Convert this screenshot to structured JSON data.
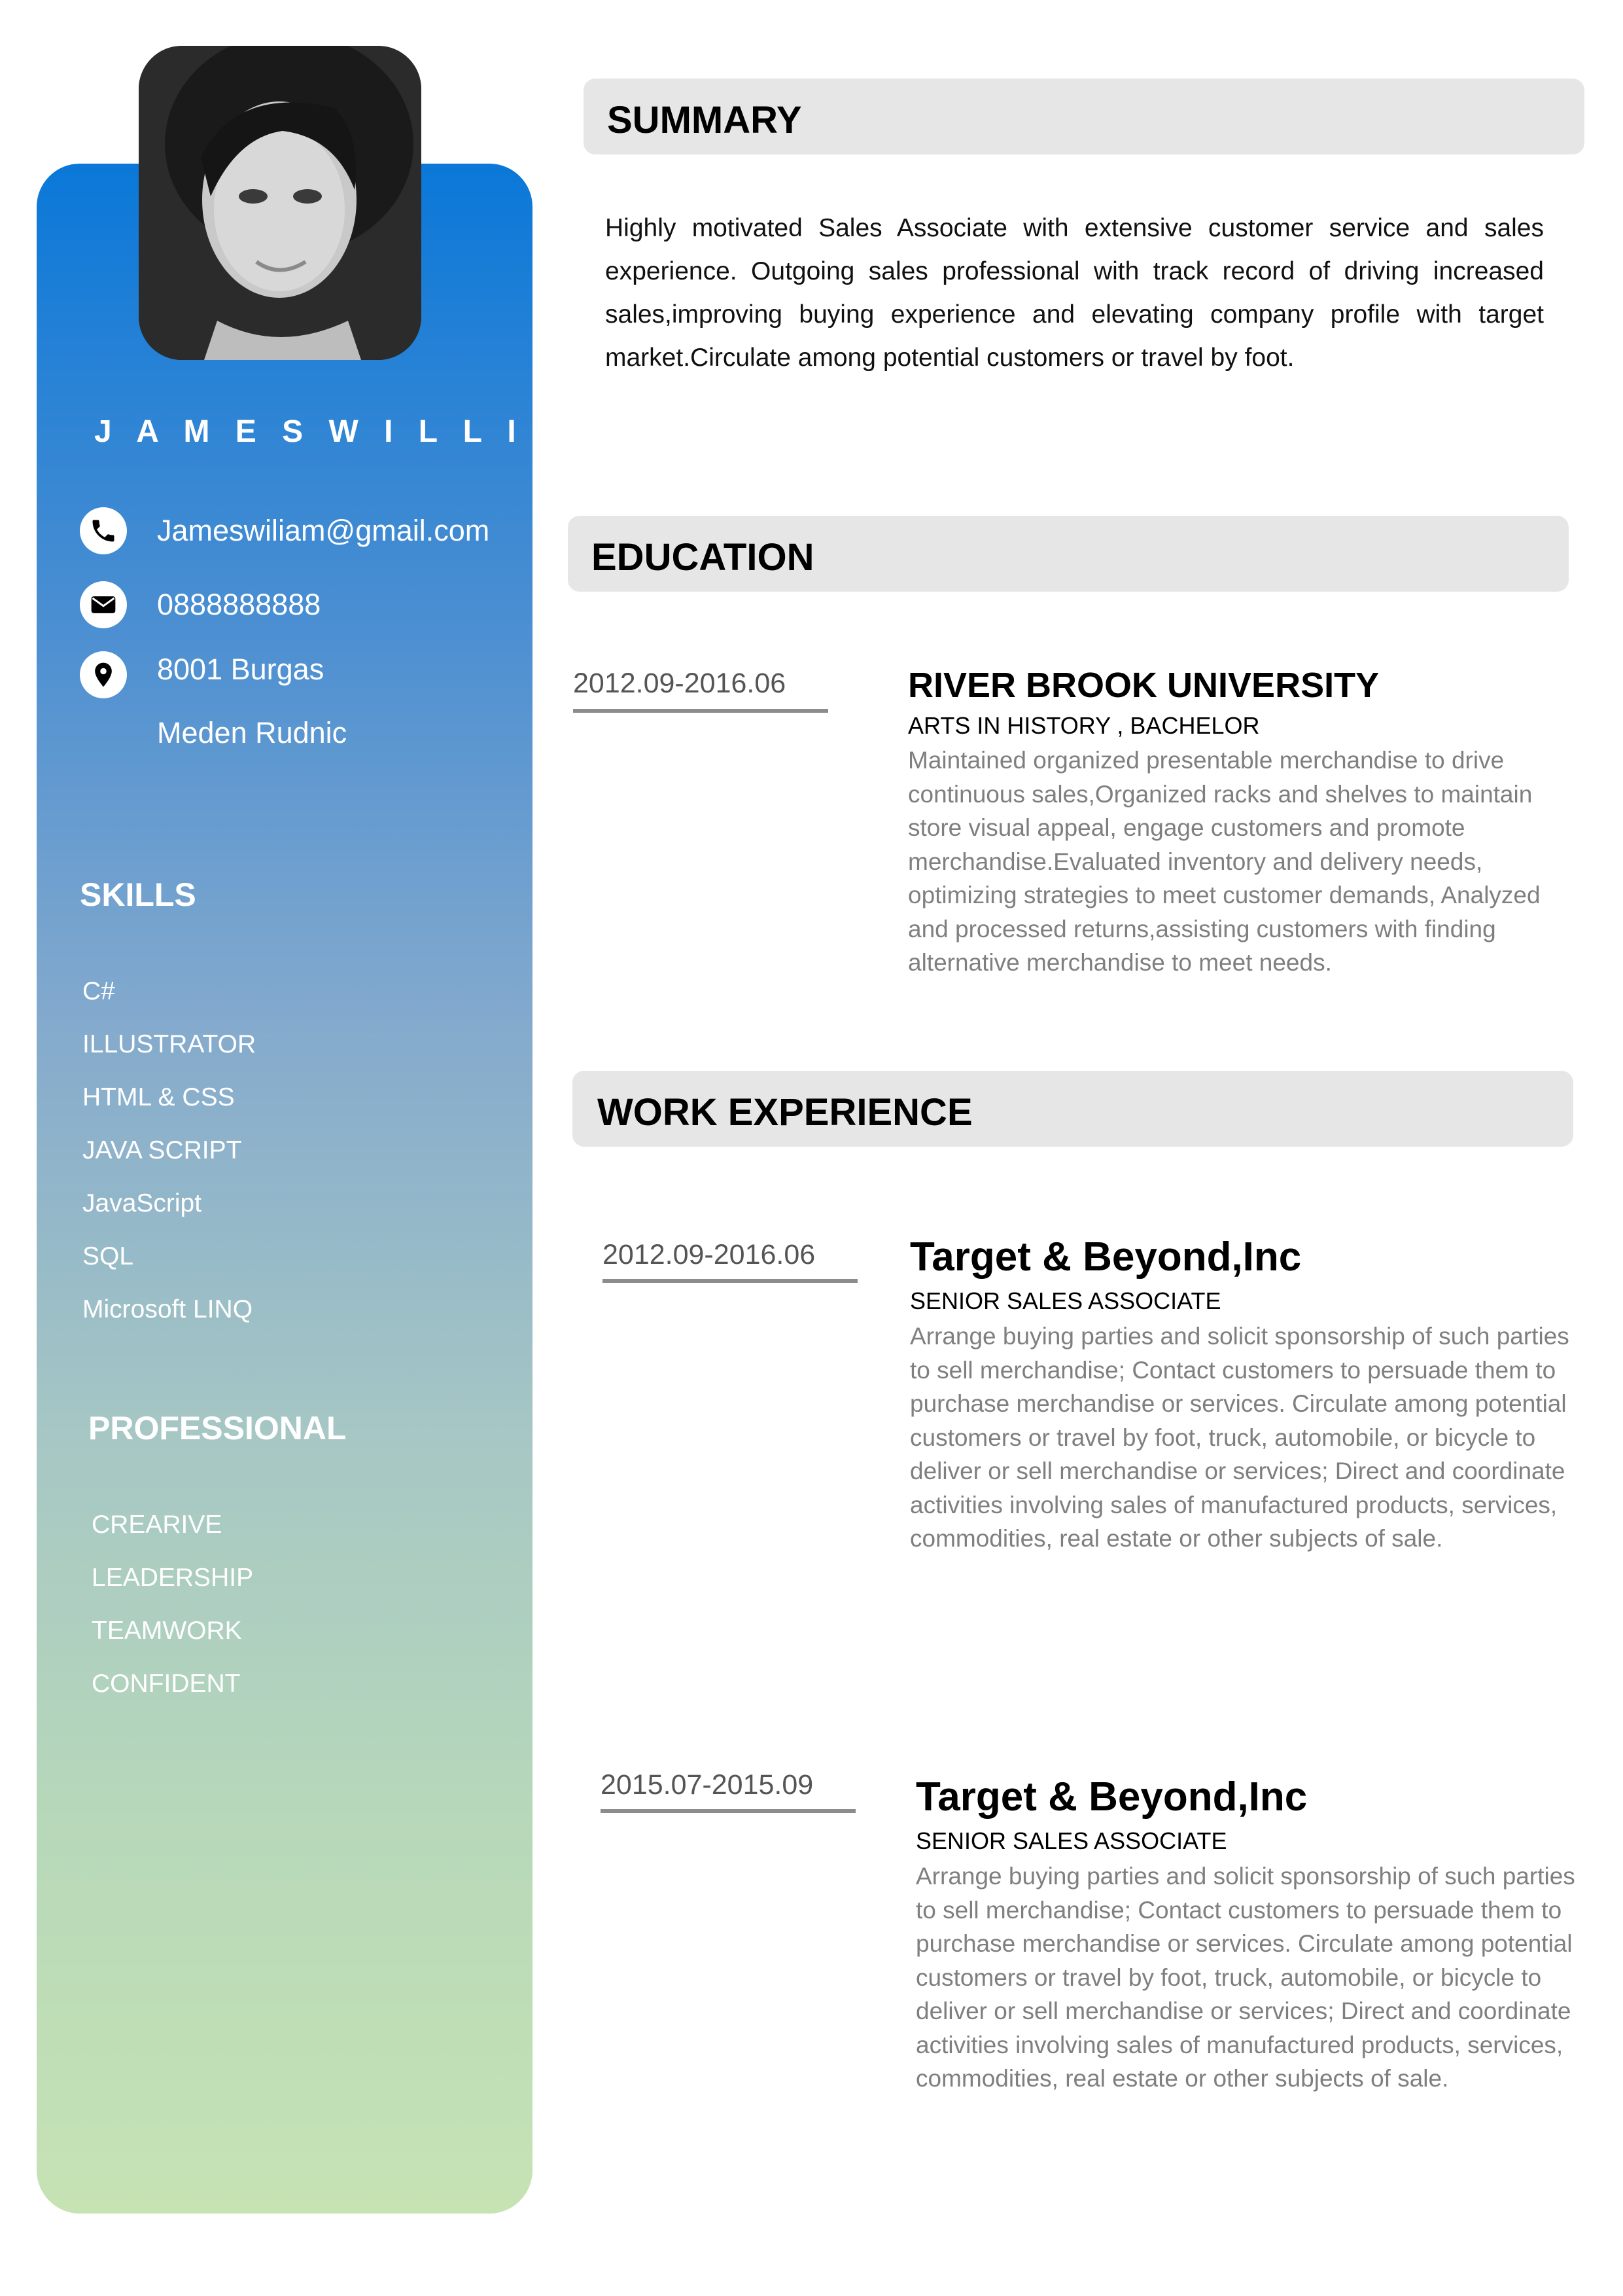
{
  "profile": {
    "name": "J A M E S W I L L I A M"
  },
  "contact": {
    "email": "Jameswiliam@gmail.com",
    "phone": "0888888888",
    "address_line1": "8001 Burgas",
    "address_line2": "Meden Rudnic",
    "icons": [
      "phone-icon",
      "mail-icon",
      "location-icon"
    ]
  },
  "skills": {
    "title": "SKILLS",
    "items": [
      "C#",
      "ILLUSTRATOR",
      "HTML & CSS",
      "JAVA SCRIPT",
      "JavaScript",
      "SQL",
      "Microsoft LINQ"
    ]
  },
  "professional": {
    "title": "PROFESSIONAL",
    "items": [
      "CREARIVE",
      "LEADERSHIP",
      "TEAMWORK",
      "CONFIDENT"
    ]
  },
  "summary": {
    "title": "SUMMARY",
    "text": "Highly motivated Sales Associate with extensive customer service and sales experience. Outgoing sales professional with track record of driving increased sales,improving buying experience and elevating company profile with target market.Circulate among potential customers or travel by foot."
  },
  "education": {
    "title": "EDUCATION",
    "entries": [
      {
        "date": "2012.09-2016.06",
        "school": "RIVER BROOK UNIVERSITY",
        "degree": "ARTS IN HISTORY , BACHELOR",
        "description": "Maintained organized presentable merchandise to drive continuous sales,Organized racks and shelves to maintain store visual appeal, engage customers and promote merchandise.Evaluated inventory and delivery needs, optimizing strategies to meet customer demands, Analyzed and processed returns,assisting customers with finding alternative merchandise to meet needs."
      }
    ]
  },
  "work": {
    "title": "WORK EXPERIENCE",
    "entries": [
      {
        "date": "2012.09-2016.06",
        "company": "Target & Beyond,Inc",
        "role": "SENIOR SALES ASSOCIATE",
        "description": "Arrange buying parties and solicit sponsorship of such parties to sell merchandise; Contact customers to persuade them to purchase merchandise or services. Circulate among potential customers or travel by foot, truck, automobile, or bicycle to deliver or sell merchandise or services; Direct and coordinate activities involving sales of manufactured products, services, commodities, real estate or other subjects of sale."
      },
      {
        "date": "2015.07-2015.09",
        "company": "Target & Beyond,Inc",
        "role": "SENIOR SALES ASSOCIATE",
        "description": "Arrange buying parties and solicit sponsorship of such parties to sell merchandise; Contact customers to persuade them to purchase merchandise or services. Circulate among potential customers or travel by foot, truck, automobile, or bicycle to deliver or sell merchandise or services; Direct and coordinate activities involving sales of manufactured products, services, commodities, real estate or other subjects of sale."
      }
    ]
  },
  "colors": {
    "sidebar_top": "#0a78d8",
    "sidebar_bottom": "#c6e3b4",
    "section_bar": "#e6e6e6",
    "body_gray": "#7f7f7f"
  }
}
